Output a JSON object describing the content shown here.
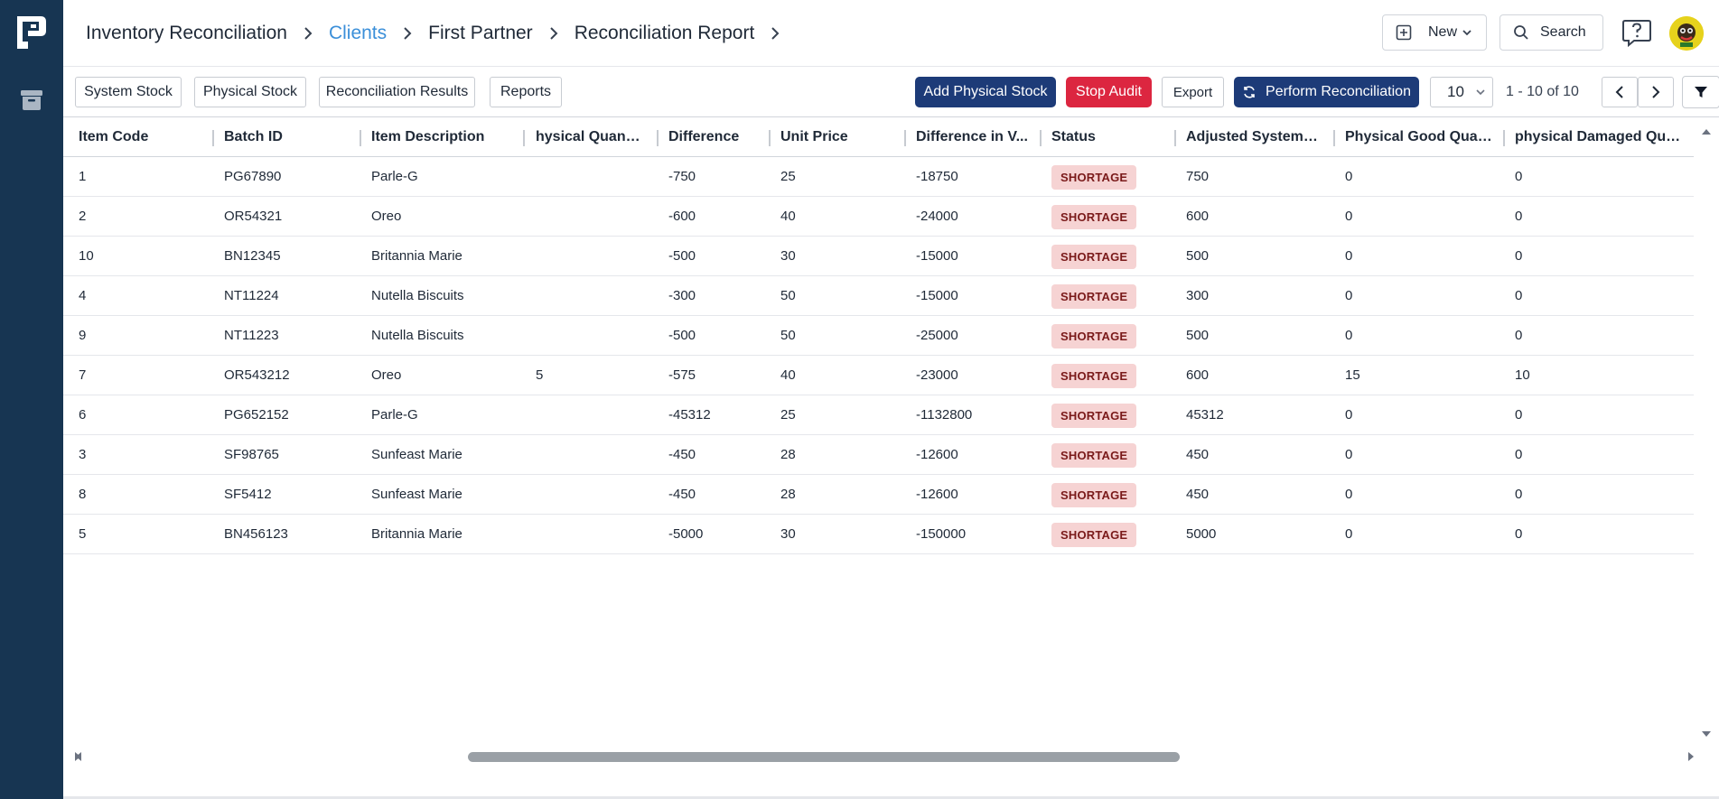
{
  "breadcrumbs": [
    {
      "label": "Inventory Reconciliation"
    },
    {
      "label": "Clients"
    },
    {
      "label": "First Partner"
    },
    {
      "label": "Reconciliation Report"
    }
  ],
  "header": {
    "new_label": "New",
    "search_label": "Search"
  },
  "toolbar": {
    "tabs": [
      "System Stock",
      "Physical Stock",
      "Reconciliation Results",
      "Reports"
    ],
    "add_physical_stock": "Add Physical Stock",
    "stop_audit": "Stop Audit",
    "export": "Export",
    "perform_reconciliation": "Perform Reconciliation",
    "page_size": "10",
    "page_range": "1 - 10 of 10"
  },
  "table": {
    "columns": [
      "Item Code",
      "Batch ID",
      "Item Description",
      "hysical Quantity",
      "Difference",
      "Unit Price",
      "Difference in V...",
      "Status",
      "Adjusted System St...",
      "Physical Good Quant...",
      "physical Damaged Quan..."
    ],
    "rows": [
      [
        "1",
        "PG67890",
        "Parle-G",
        "",
        "-750",
        "25",
        "-18750",
        "SHORTAGE",
        "750",
        "0",
        "0"
      ],
      [
        "2",
        "OR54321",
        "Oreo",
        "",
        "-600",
        "40",
        "-24000",
        "SHORTAGE",
        "600",
        "0",
        "0"
      ],
      [
        "10",
        "BN12345",
        "Britannia Marie",
        "",
        "-500",
        "30",
        "-15000",
        "SHORTAGE",
        "500",
        "0",
        "0"
      ],
      [
        "4",
        "NT11224",
        "Nutella Biscuits",
        "",
        "-300",
        "50",
        "-15000",
        "SHORTAGE",
        "300",
        "0",
        "0"
      ],
      [
        "9",
        "NT11223",
        "Nutella Biscuits",
        "",
        "-500",
        "50",
        "-25000",
        "SHORTAGE",
        "500",
        "0",
        "0"
      ],
      [
        "7",
        "OR543212",
        "Oreo",
        "5",
        "-575",
        "40",
        "-23000",
        "SHORTAGE",
        "600",
        "15",
        "10"
      ],
      [
        "6",
        "PG652152",
        "Parle-G",
        "",
        "-45312",
        "25",
        "-1132800",
        "SHORTAGE",
        "45312",
        "0",
        "0"
      ],
      [
        "3",
        "SF98765",
        "Sunfeast Marie",
        "",
        "-450",
        "28",
        "-12600",
        "SHORTAGE",
        "450",
        "0",
        "0"
      ],
      [
        "8",
        "SF5412",
        "Sunfeast Marie",
        "",
        "-450",
        "28",
        "-12600",
        "SHORTAGE",
        "450",
        "0",
        "0"
      ],
      [
        "5",
        "BN456123",
        "Britannia Marie",
        "",
        "-5000",
        "30",
        "-150000",
        "SHORTAGE",
        "5000",
        "0",
        "0"
      ]
    ]
  },
  "icons": {
    "logo": "fp-logo-icon",
    "archive": "archive-icon",
    "new": "plus-square-icon",
    "search": "search-icon",
    "help": "help-icon",
    "refresh": "refresh-icon",
    "filter": "filter-icon"
  },
  "colors": {
    "rail": "#173552",
    "active_crumb": "#3b8fd9",
    "primary": "#1d3b78",
    "danger": "#dc2640",
    "badge_bg": "#f6d3d3",
    "badge_text": "#7a1a1a"
  }
}
